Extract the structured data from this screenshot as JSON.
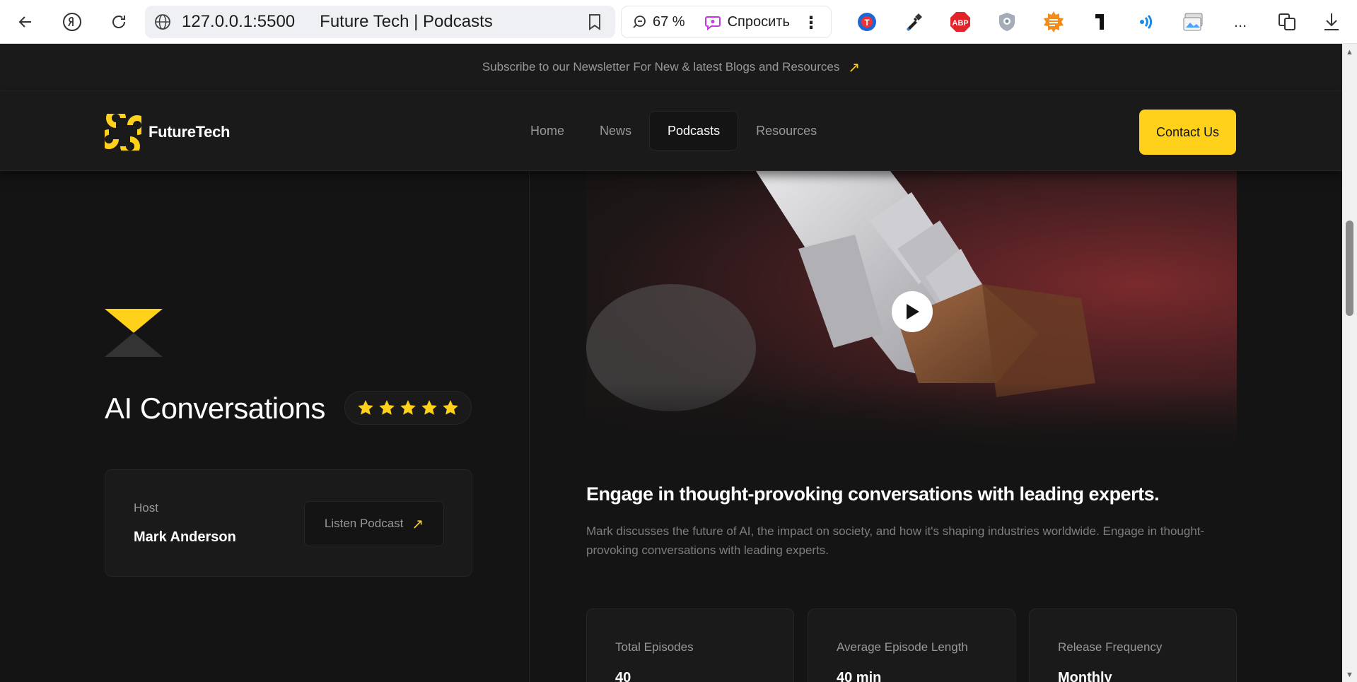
{
  "browser": {
    "url": "127.0.0.1:5500",
    "tab_title": "Future Tech | Podcasts",
    "zoom": "67 %",
    "ask_label": "Спросить",
    "more_label": "..."
  },
  "site": {
    "newsletter_text": "Subscribe to our Newsletter For New & latest Blogs and Resources",
    "logo_text": "FutureTech",
    "nav": [
      "Home",
      "News",
      "Podcasts",
      "Resources"
    ],
    "active_nav": "Podcasts",
    "contact_label": "Contact Us",
    "accent_color": "#ffd11a"
  },
  "podcast": {
    "title": "AI Conversations",
    "rating_stars": 5,
    "host_label": "Host",
    "host_name": "Mark Anderson",
    "listen_label": "Listen Podcast",
    "headline": "Engage in thought-provoking conversations with leading experts.",
    "description": "Mark discusses the future of AI, the impact on society, and how it's shaping industries worldwide. Engage in thought-provoking conversations with leading experts.",
    "stats": [
      {
        "label": "Total Episodes",
        "value": "40"
      },
      {
        "label": "Average Episode Length",
        "value": "40 min"
      },
      {
        "label": "Release Frequency",
        "value": "Monthly"
      }
    ]
  }
}
